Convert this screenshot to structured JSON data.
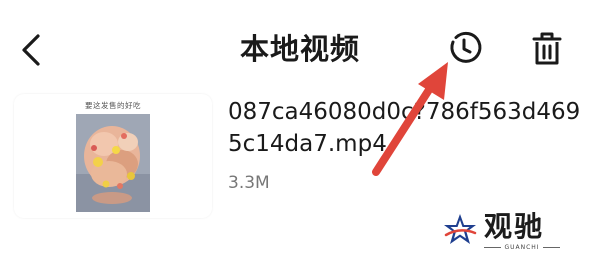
{
  "header": {
    "title": "本地视频",
    "back_icon": "chevron-left-icon",
    "history_icon": "history-icon",
    "delete_icon": "trash-icon"
  },
  "video": {
    "thumbnail_caption": "要这发售的好吃",
    "filename": "087ca46080d0c?786f563d4695c14da7.mp4",
    "size": "3.3M"
  },
  "annotation": {
    "arrow_color": "#e0453a"
  },
  "watermark": {
    "name": "观驰",
    "sub": "GUANCHI"
  },
  "colors": {
    "text": "#1a1a1a",
    "secondary": "#777777",
    "arrow": "#e0453a"
  }
}
